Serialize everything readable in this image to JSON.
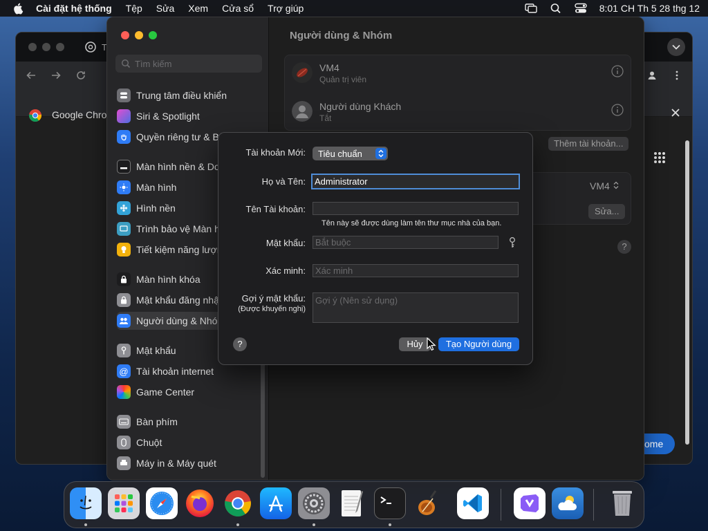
{
  "menubar": {
    "app_name": "Cài đặt hệ thống",
    "menus": [
      "Tệp",
      "Sửa",
      "Xem",
      "Cửa sổ",
      "Trợ giúp"
    ],
    "clock": "8:01 CH Th 5 28 thg 12"
  },
  "chrome": {
    "tab_title": "T",
    "bookmark_title": "Google Chrom",
    "home_button_partial": "ome"
  },
  "settings": {
    "search_placeholder": "Tìm kiếm",
    "sidebar_items": [
      "Trung tâm điều khiển",
      "Siri & Spotlight",
      "Quyền riêng tư & Bả",
      "Màn hình nền & Doc",
      "Màn hình",
      "Hình nền",
      "Trình bảo vệ Màn hì",
      "Tiết kiệm năng lượn",
      "Màn hình khóa",
      "Mật khẩu đăng nhập",
      "Người dùng & Nhóm",
      "Mật khẩu",
      "Tài khoản internet",
      "Game Center",
      "Bàn phím",
      "Chuột",
      "Máy in & Máy quét"
    ],
    "page_title": "Người dùng & Nhóm",
    "users": [
      {
        "name": "VM4",
        "role": "Quản trị viên"
      },
      {
        "name": "Người dùng Khách",
        "role": "Tắt"
      }
    ],
    "add_account_button": "Thêm tài khoản...",
    "auto_login_value": "VM4",
    "edit_button": "Sửa...",
    "help": "?"
  },
  "dialog": {
    "new_account_label": "Tài khoản Mới:",
    "account_type": "Tiêu chuẩn",
    "full_name_label": "Họ và Tên:",
    "full_name_value": "Administrator",
    "account_name_label": "Tên Tài khoản:",
    "account_name_value": "",
    "account_name_hint": "Tên này sẽ được dùng làm tên thư mục nhà của bạn.",
    "password_label": "Mật khẩu:",
    "password_placeholder": "Bắt buộc",
    "verify_label": "Xác minh:",
    "verify_placeholder": "Xác minh",
    "hint_label": "Gợi ý mật khẩu:",
    "hint_sublabel": "(Được khuyến nghị)",
    "hint_placeholder": "Gợi ý (Nên sử dụng)",
    "help": "?",
    "cancel_button": "Hủy",
    "create_button": "Tạo Người dùng"
  },
  "dock": {
    "apps": [
      "finder-icon",
      "launchpad-icon",
      "safari-icon",
      "firefox-icon",
      "chrome-icon",
      "app-store-icon",
      "system-settings-icon",
      "textedit-icon",
      "terminal-icon",
      "garageband-icon",
      "vscode-icon",
      "visual-studio-icon",
      "weather-icon",
      "trash-icon"
    ]
  },
  "colors": {
    "accent": "#1f6fe0",
    "focus_ring": "#4f8dd8"
  }
}
